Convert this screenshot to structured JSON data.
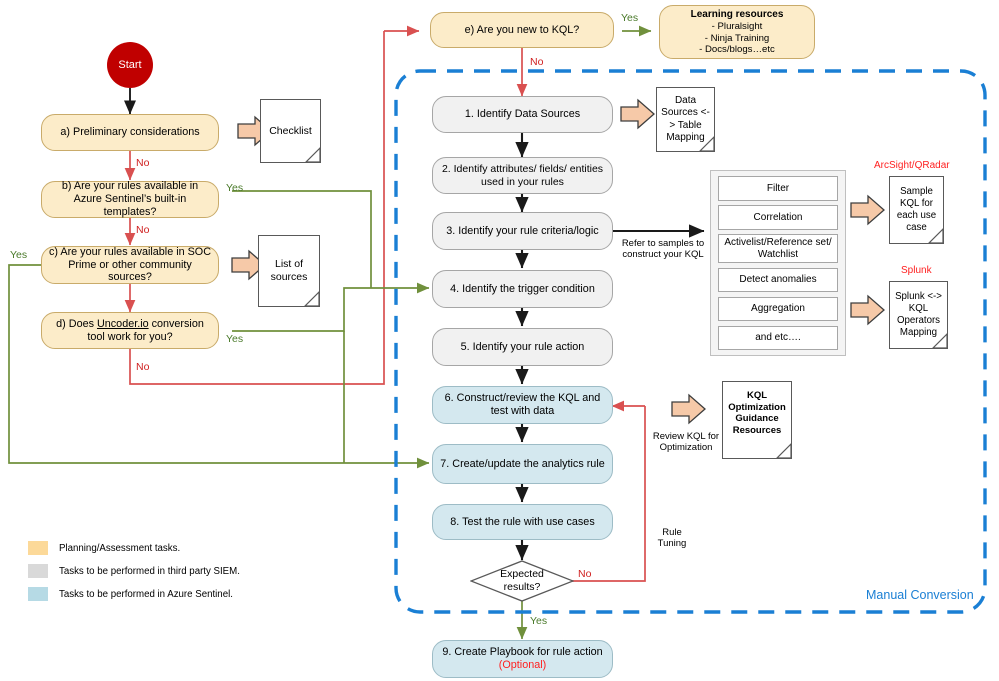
{
  "colors": {
    "planning": "#fcecc9",
    "third_party": "#f1f1f1",
    "sentinel": "#d4e8ef",
    "start_fill": "#c00000",
    "yes_line": "#70903c",
    "no_line": "#d95050",
    "black_line": "#1a1a1a",
    "dashed_box": "#1a7fd4",
    "arrow_fill": "#f6c9a8",
    "red_text": "#ff2020"
  },
  "start": {
    "label": "Start"
  },
  "decisions": {
    "a": "a) Preliminary considerations",
    "b": "b) Are your rules available in Azure Sentinel’s built-in templates?",
    "c": "c) Are your rules available in SOC Prime or other community sources?",
    "d_pre": "d) Does ",
    "d_link": "Uncoder.io",
    "d_post": " conversion tool work for you?",
    "e": "e) Are you new to KQL?"
  },
  "steps": {
    "s1": "1. Identify Data Sources",
    "s2": "2. Identify attributes/ fields/ entities used in your rules",
    "s3": "3. Identify your rule criteria/logic",
    "s4": "4. Identify the trigger condition",
    "s5": "5. Identify your rule action",
    "s6": "6. Construct/review the KQL and test with data",
    "s7": "7. Create/update the analytics rule",
    "s8": "8. Test the rule with use cases",
    "s9_main": "9. Create Playbook for rule action",
    "s9_sub": "(Optional)"
  },
  "diamond": {
    "line1": "Expected",
    "line2": "results?"
  },
  "documents": {
    "checklist": "Checklist",
    "list_of_sources": "List of sources",
    "data_sources_mapping": "Data Sources <-> Table Mapping",
    "sample_kql": "Sample KQL for each use case",
    "splunk_mapping": "Splunk <-> KQL Operators Mapping",
    "kql_optimization": "KQL Optimization Guidance Resources"
  },
  "learning": {
    "title": "Learning resources",
    "items": [
      "- Pluralsight",
      "- Ninja Training",
      "- Docs/blogs…etc"
    ]
  },
  "sublist": {
    "rows": [
      "Filter",
      "Correlation",
      "Activelist/Reference set/ Watchlist",
      "Detect anomalies",
      "Aggregation",
      "and etc…."
    ]
  },
  "annotations": {
    "arcsight": "ArcSight/QRadar",
    "splunk": "Splunk",
    "refer_to_samples": "Refer to samples to construct your KQL",
    "review_kql": "Review KQL for Optimization",
    "rule_tuning": "Rule Tuning",
    "manual_conversion": "Manual Conversion"
  },
  "edge_labels": {
    "yes": "Yes",
    "no": "No"
  },
  "legend": {
    "items": [
      {
        "color": "#fcd999",
        "text": "Planning/Assessment tasks."
      },
      {
        "color": "#d9d9d9",
        "text": "Tasks to be performed in third party SIEM."
      },
      {
        "color": "#b6dae5",
        "text": "Tasks to be performed in Azure Sentinel."
      }
    ]
  }
}
